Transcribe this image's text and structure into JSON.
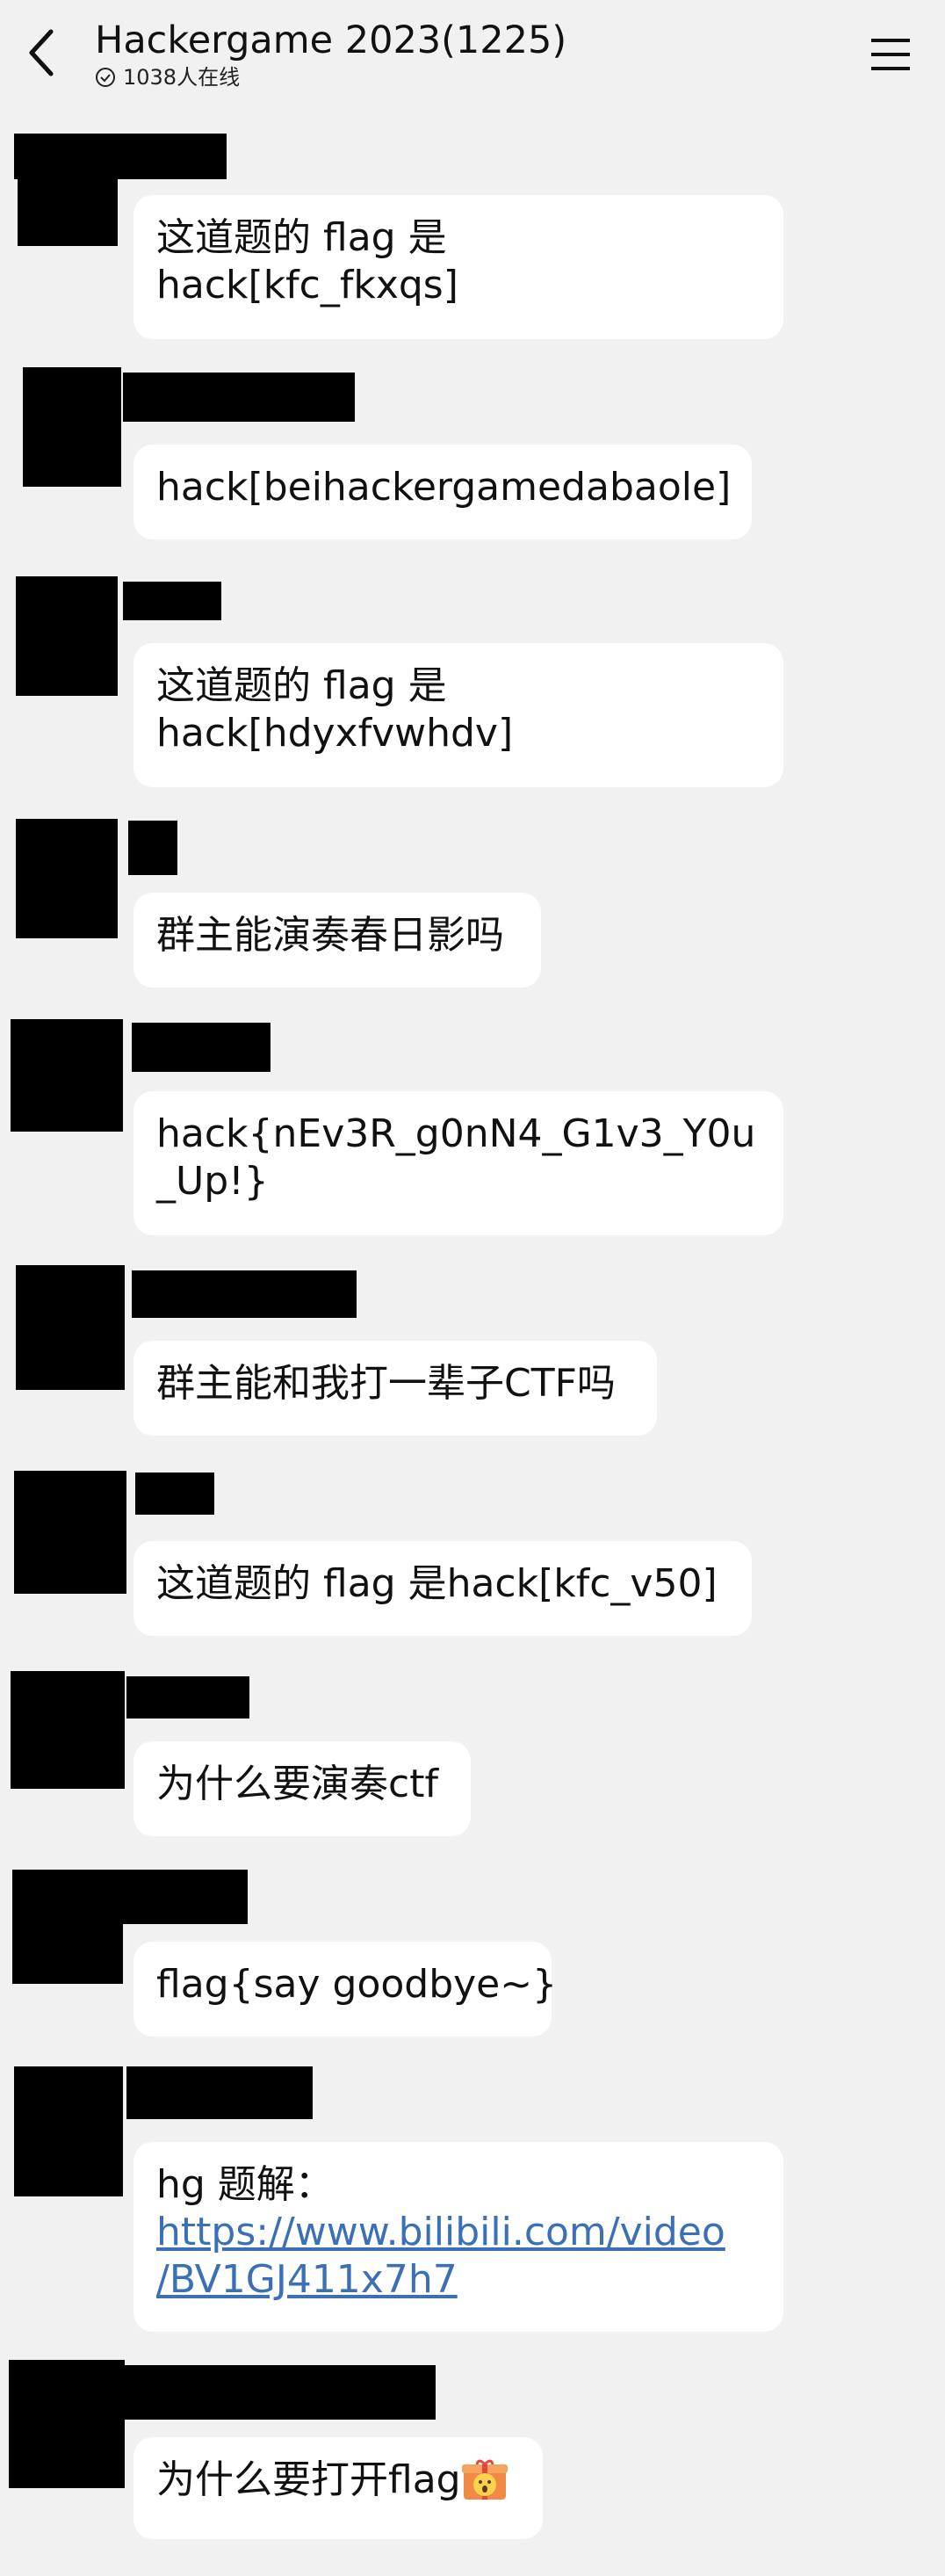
{
  "header": {
    "title": "Hackergame 2023(1225)",
    "online": "1038人在线"
  },
  "messages": [
    {
      "lines": [
        "这道题的 flag 是",
        "hack[kfc_fkxqs]"
      ]
    },
    {
      "lines": [
        "hack[beihackergamedabaole]"
      ]
    },
    {
      "lines": [
        "这道题的 flag 是",
        "hack[hdyxfvwhdv]"
      ]
    },
    {
      "lines": [
        "群主能演奏春日影吗"
      ]
    },
    {
      "lines": [
        "hack{nEv3R_g0nN4_G1v3_Y0u",
        "_Up!}"
      ]
    },
    {
      "lines": [
        "群主能和我打一辈子CTF吗"
      ]
    },
    {
      "lines": [
        "这道题的 flag 是hack[kfc_v50]"
      ]
    },
    {
      "lines": [
        "为什么要演奏ctf"
      ]
    },
    {
      "lines": [
        "flag{say goodbye~}"
      ]
    },
    {
      "prefix": "hg 题解：",
      "link_lines": [
        "https://www.bilibili.com/video",
        "/BV1GJ411x7h7"
      ]
    },
    {
      "text": "为什么要打开flag",
      "emoji": "surprised-gift-emoji"
    }
  ],
  "colors": {
    "background": "#f1f1f1",
    "bubble": "#ffffff",
    "link": "#3b6fb6",
    "redaction": "#000000"
  }
}
